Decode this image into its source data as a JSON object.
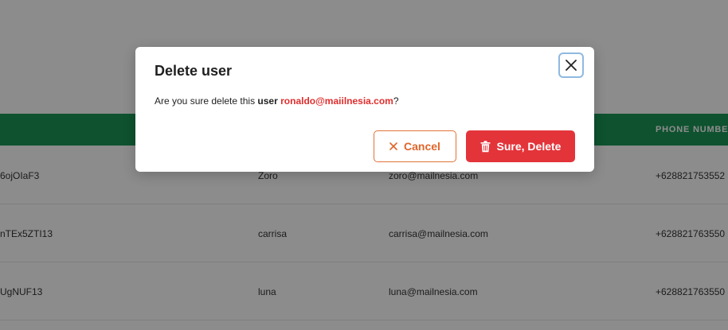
{
  "table": {
    "phone_header": "PHONE NUMBER",
    "rows": [
      {
        "id": "6ojOIaF3",
        "name": "Zoro",
        "email": "zoro@mailnesia.com",
        "phone": "+628821753552"
      },
      {
        "id": "nTEx5ZTI13",
        "name": "carrisa",
        "email": "carrisa@mailnesia.com",
        "phone": "+628821763550"
      },
      {
        "id": "UgNUF13",
        "name": "luna",
        "email": "luna@mailnesia.com",
        "phone": "+628821763550"
      }
    ]
  },
  "modal": {
    "title": "Delete user",
    "message_prefix": "Are you sure delete this ",
    "message_user_label": "user",
    "message_email": "ronaldo@maiilnesia.com",
    "message_suffix": "?",
    "cancel_label": "Cancel",
    "delete_label": "Sure, Delete",
    "close_icon": "close-icon",
    "cancel_icon": "x-icon",
    "delete_icon": "trash-icon"
  },
  "colors": {
    "table_header": "#1a9656",
    "cancel_accent": "#e0652a",
    "delete_button": "#e3343a",
    "email_highlight": "#e02d2d",
    "close_focus_ring": "#8fb9e0"
  }
}
